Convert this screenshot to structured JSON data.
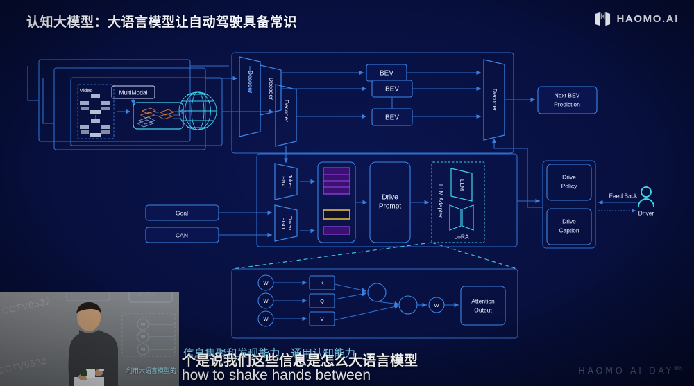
{
  "header": {
    "title": "认知大模型：大语言模型让自动驾驶具备常识",
    "logo_text": "HAOMO.AI",
    "logo_icon": "haomo-m-mark"
  },
  "diagram": {
    "input_stack": {
      "video_label": "Video",
      "multimodal_label": "MultiModal",
      "fusion_icon": "layered-feature-maps-icon",
      "globe_icon": "wireframe-globe-icon",
      "frames": 3
    },
    "decoders": [
      {
        "label": "Decoder"
      },
      {
        "label": "Decoder"
      },
      {
        "label": "Decoder"
      }
    ],
    "bev_boxes": [
      {
        "label": "BEV"
      },
      {
        "label": "BEV"
      },
      {
        "label": "BEV"
      }
    ],
    "output_decoder": {
      "label": "Decoder"
    },
    "next_bev": {
      "label_line1": "Next BEV",
      "label_line2": "Prediction"
    },
    "tokens": {
      "env": {
        "line1": "ENV",
        "line2": "Token"
      },
      "ego": {
        "line1": "EGO",
        "line2": "Token"
      }
    },
    "inputs": [
      {
        "label": "Goal"
      },
      {
        "label": "CAN"
      }
    ],
    "token_bars": {
      "purple_rows": 4,
      "highlight_color": "#e8b93c",
      "purple_color": "#8b3fd6",
      "tail_rows": 1
    },
    "drive_prompt": {
      "line1": "Drive",
      "line2": "Prompt"
    },
    "llm_adapter": {
      "adapter_label": "LLM Adapter",
      "llm_label": "LLM",
      "lora_label": "LoRA"
    },
    "outputs": [
      {
        "line1": "Drive",
        "line2": "Policy"
      },
      {
        "line1": "Drive",
        "line2": "Caption"
      }
    ],
    "feedback": {
      "label": "Feed Back",
      "actor_label": "Driver",
      "actor_icon": "person-icon"
    },
    "attention": {
      "weight_label": "W",
      "weights": [
        "W",
        "W",
        "W"
      ],
      "projections": [
        "K",
        "Q",
        "V"
      ],
      "out_weight": "W",
      "output_line1": "Attention",
      "output_line2": "Output"
    }
  },
  "pip": {
    "watermark_1": "CCTV0532",
    "watermark_2": "CCTV0532",
    "slide_caption": "利用大语言模型的",
    "slide_weights": [
      "W",
      "W",
      "W"
    ],
    "person_icon": "presenter-with-microphone"
  },
  "subtitles": {
    "slide_text_cn": "信息集聚和发现能力，通用认知能力",
    "spoken_cn": "个是说我们这些信息是怎么大语言模型",
    "spoken_en": "how to shake hands between"
  },
  "footer": {
    "watermark": "HAOMO AI DAY",
    "watermark_sup": "9th"
  },
  "colors": {
    "background": "#07103f",
    "line": "#2f6fd0",
    "accent_cyan": "#3fd2ea",
    "text": "#e8edff",
    "purple": "#8b3fd6",
    "gold": "#e8b93c"
  }
}
